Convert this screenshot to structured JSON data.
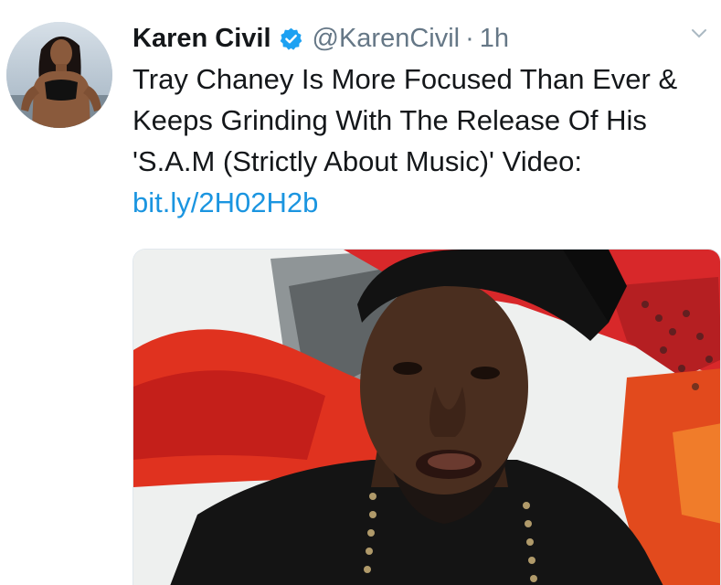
{
  "tweet": {
    "display_name": "Karen Civil",
    "handle": "@KarenCivil",
    "separator": "·",
    "time": "1h",
    "text": "Tray Chaney Is More Focused Than Ever & Keeps Grinding With The Release Of His 'S.A.M (Strictly About Music)' Video:",
    "link": "bit.ly/2H02H2b"
  },
  "icons": {
    "verified": "verified-badge-icon",
    "caret": "chevron-down-icon"
  },
  "colors": {
    "verified": "#1da1f2",
    "link": "#1b95e0",
    "secondary_text": "#657786",
    "primary_text": "#14171a"
  }
}
